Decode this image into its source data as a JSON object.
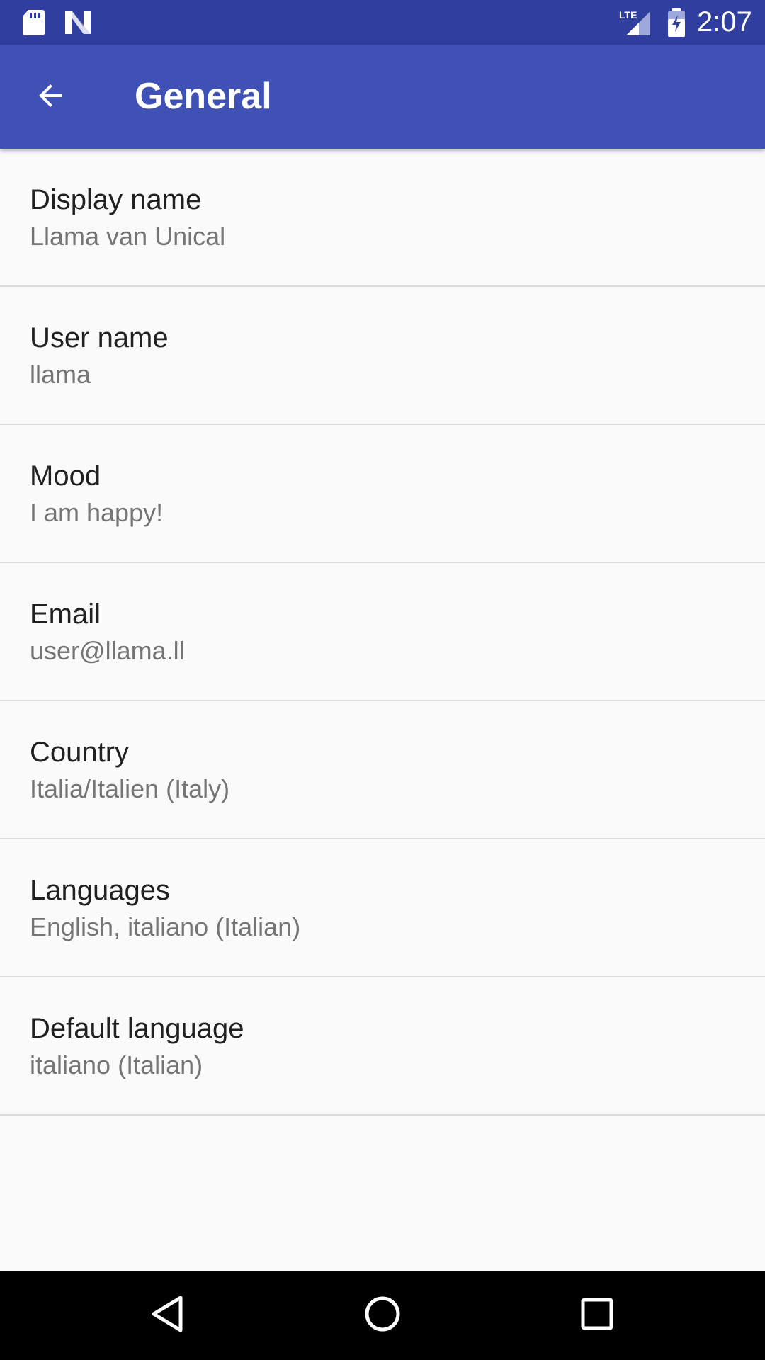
{
  "status_bar": {
    "time": "2:07",
    "network_label": "LTE",
    "icons": [
      "sd-card-icon",
      "n-notification-icon",
      "lte-signal-icon",
      "battery-charging-icon"
    ]
  },
  "app_bar": {
    "title": "General",
    "back_icon": "arrow-back-icon"
  },
  "settings": [
    {
      "title": "Display name",
      "summary": "Llama van Unical"
    },
    {
      "title": "User name",
      "summary": "llama"
    },
    {
      "title": "Mood",
      "summary": "I am happy!"
    },
    {
      "title": "Email",
      "summary": "user@llama.ll"
    },
    {
      "title": "Country",
      "summary": "Italia/Italien (Italy)"
    },
    {
      "title": "Languages",
      "summary": "English, italiano (Italian)"
    },
    {
      "title": "Default language",
      "summary": "italiano (Italian)"
    }
  ],
  "nav_bar": {
    "icons": [
      "nav-back-icon",
      "nav-home-icon",
      "nav-recents-icon"
    ]
  },
  "colors": {
    "status_bar": "#303f9f",
    "app_bar": "#3f51b5",
    "background": "#fafafa",
    "title_text": "#212121",
    "summary_text": "#757575",
    "divider": "#dcdcdc",
    "nav_bar": "#000000"
  }
}
